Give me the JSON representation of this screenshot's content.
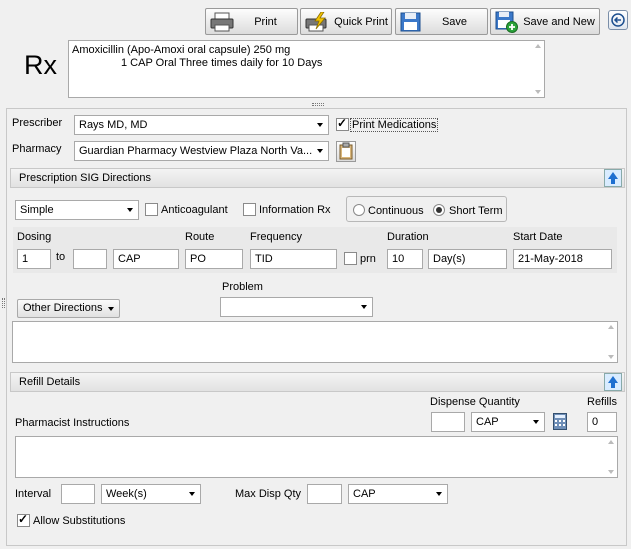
{
  "toolbar": {
    "print": "Print",
    "quick_print": "Quick Print",
    "save": "Save",
    "save_and_new": "Save and New"
  },
  "rx_label": "Rx",
  "rx_summary_line1": "Amoxicillin (Apo-Amoxi oral capsule) 250 mg",
  "rx_summary_line2": "1 CAP Oral Three times daily for 10 Days",
  "prescriber": {
    "label": "Prescriber",
    "value": "Rays MD, MD"
  },
  "print_medications": {
    "label": "Print Medications",
    "checked": true
  },
  "pharmacy": {
    "label": "Pharmacy",
    "value": "Guardian Pharmacy Westview Plaza North Va..."
  },
  "sig": {
    "title": "Prescription SIG Directions",
    "mode": "Simple",
    "anticoagulant": "Anticoagulant",
    "information_rx": "Information Rx",
    "continuous": "Continuous",
    "short_term": "Short Term",
    "dosing_label": "Dosing",
    "to_label": "to",
    "dosing_from": "1",
    "dosing_to": "",
    "dosing_unit": "CAP",
    "route_label": "Route",
    "route": "PO",
    "frequency_label": "Frequency",
    "frequency": "TID",
    "prn": "prn",
    "duration_label": "Duration",
    "duration": "10",
    "duration_unit": "Day(s)",
    "start_date_label": "Start Date",
    "start_date": "21-May-2018",
    "other_directions": "Other Directions",
    "problem_label": "Problem",
    "problem": ""
  },
  "refill": {
    "title": "Refill Details",
    "dispense_quantity_label": "Dispense Quantity",
    "dispense_quantity": "",
    "dispense_unit": "CAP",
    "refills_label": "Refills",
    "refills": "0",
    "pharmacist_instructions": "Pharmacist Instructions",
    "interval_label": "Interval",
    "interval": "",
    "interval_unit": "Week(s)",
    "max_disp_label": "Max Disp Qty",
    "max_disp": "",
    "max_disp_unit": "CAP",
    "allow_substitutions": "Allow Substitutions",
    "allow_substitutions_checked": true
  }
}
